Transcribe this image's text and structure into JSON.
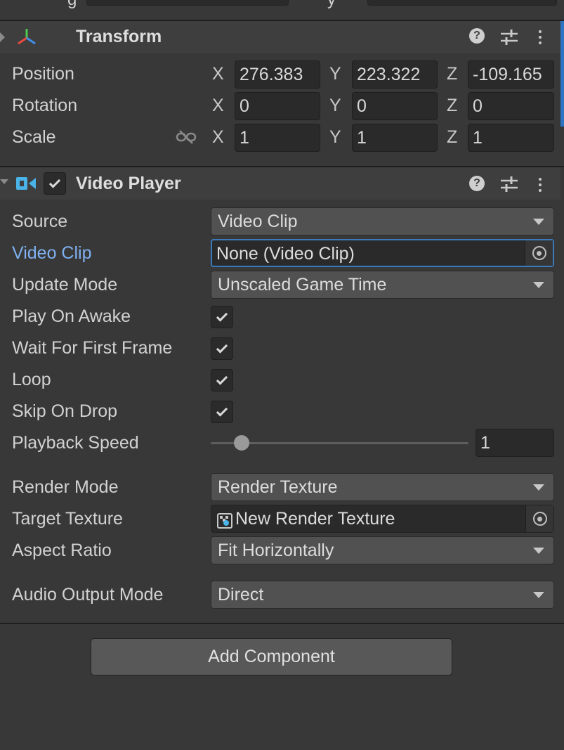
{
  "top_row": {
    "label_a": "g",
    "label_b": "y"
  },
  "transform": {
    "title": "Transform",
    "rows": [
      {
        "label": "Position",
        "x": "276.383",
        "y": "223.322",
        "z": "-109.165"
      },
      {
        "label": "Rotation",
        "x": "0",
        "y": "0",
        "z": "0"
      },
      {
        "label": "Scale",
        "x": "1",
        "y": "1",
        "z": "1"
      }
    ],
    "axes": {
      "x": "X",
      "y": "Y",
      "z": "Z"
    }
  },
  "video_player": {
    "title": "Video Player",
    "enabled": true,
    "source": {
      "label": "Source",
      "value": "Video Clip"
    },
    "video_clip": {
      "label": "Video Clip",
      "value": "None (Video Clip)"
    },
    "update_mode": {
      "label": "Update Mode",
      "value": "Unscaled Game Time"
    },
    "play_on_awake": {
      "label": "Play On Awake",
      "checked": true
    },
    "wait_for_first_frame": {
      "label": "Wait For First Frame",
      "checked": true
    },
    "loop": {
      "label": "Loop",
      "checked": true
    },
    "skip_on_drop": {
      "label": "Skip On Drop",
      "checked": true
    },
    "playback_speed": {
      "label": "Playback Speed",
      "value": "1",
      "slider_fraction": 0.12
    },
    "render_mode": {
      "label": "Render Mode",
      "value": "Render Texture"
    },
    "target_texture": {
      "label": "Target Texture",
      "value": "New Render Texture"
    },
    "aspect_ratio": {
      "label": "Aspect Ratio",
      "value": "Fit Horizontally"
    },
    "audio_output_mode": {
      "label": "Audio Output Mode",
      "value": "Direct"
    }
  },
  "add_component_label": "Add Component",
  "colors": {
    "accent_blue": "#3a79bb",
    "label_blue": "#7fb0f0",
    "transform_icon": [
      "#e84a3c",
      "#4ec94e",
      "#3f8fe8"
    ],
    "video_icon": "#4ab3e8"
  }
}
